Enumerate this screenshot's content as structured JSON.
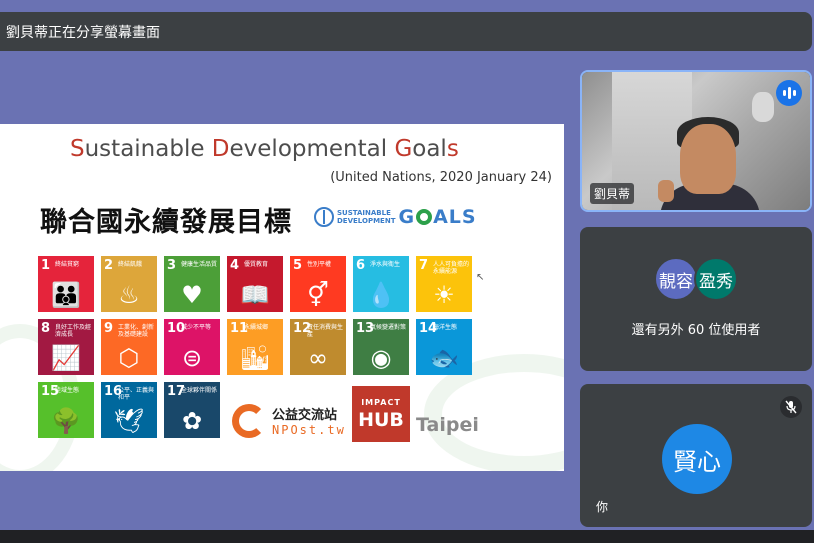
{
  "banner": {
    "text": "劉貝蒂正在分享螢幕畫面"
  },
  "slide": {
    "title_parts": [
      "S",
      "ustainable ",
      "D",
      "evelopmental ",
      "G",
      "oal",
      "s"
    ],
    "date": "(United Nations, 2020 January 24)",
    "cn_title": "聯合國永續發展目標",
    "goals_logo": {
      "small_line1": "SUSTAINABLE",
      "small_line2": "DEVELOPMENT",
      "big_g": "G",
      "big_rest": "ALS"
    },
    "tiles": [
      {
        "num": "1",
        "label": "終結貧窮",
        "icon": "family-icon",
        "glyph": "👪",
        "color": "#e5243b"
      },
      {
        "num": "2",
        "label": "終結飢餓",
        "icon": "bowl-icon",
        "glyph": "♨",
        "color": "#dda63a"
      },
      {
        "num": "3",
        "label": "健康生活品質",
        "icon": "heartbeat-icon",
        "glyph": "♥",
        "color": "#4c9f38"
      },
      {
        "num": "4",
        "label": "優質教育",
        "icon": "book-icon",
        "glyph": "📖",
        "color": "#c5192d"
      },
      {
        "num": "5",
        "label": "性別平權",
        "icon": "gender-icon",
        "glyph": "⚥",
        "color": "#ff3a21"
      },
      {
        "num": "6",
        "label": "淨水與衛生",
        "icon": "water-icon",
        "glyph": "💧",
        "color": "#26bde2"
      },
      {
        "num": "7",
        "label": "人人可負擔的永續能源",
        "icon": "sun-icon",
        "glyph": "☀",
        "color": "#fcc30b"
      },
      {
        "num": "8",
        "label": "良好工作及經濟成長",
        "icon": "growth-icon",
        "glyph": "📈",
        "color": "#a21942"
      },
      {
        "num": "9",
        "label": "工業化、創新及基礎建設",
        "icon": "cubes-icon",
        "glyph": "⬡",
        "color": "#fd6925"
      },
      {
        "num": "10",
        "label": "減少不平等",
        "icon": "equal-icon",
        "glyph": "⊜",
        "color": "#dd1367"
      },
      {
        "num": "11",
        "label": "永續城鄉",
        "icon": "city-icon",
        "glyph": "🏙",
        "color": "#fd9d24"
      },
      {
        "num": "12",
        "label": "責任消費與生產",
        "icon": "infinity-icon",
        "glyph": "∞",
        "color": "#bf8b2e"
      },
      {
        "num": "13",
        "label": "氣候變遷對策",
        "icon": "eye-icon",
        "glyph": "◉",
        "color": "#3f7e44"
      },
      {
        "num": "14",
        "label": "海洋生態",
        "icon": "fish-icon",
        "glyph": "🐟",
        "color": "#0a97d9"
      },
      {
        "num": "15",
        "label": "陸域生態",
        "icon": "tree-icon",
        "glyph": "🌳",
        "color": "#56c02b"
      },
      {
        "num": "16",
        "label": "公平、正義與和平",
        "icon": "dove-icon",
        "glyph": "🕊",
        "color": "#00689d"
      },
      {
        "num": "17",
        "label": "全球夥伴關係",
        "icon": "flower-icon",
        "glyph": "✿",
        "color": "#19486a"
      }
    ],
    "npo": {
      "cn": "公益交流站",
      "en": "NPOst.tw"
    },
    "hub": {
      "top": "IMPACT",
      "bottom": "HUB"
    },
    "taipei": "Taipei"
  },
  "tile1": {
    "name": "劉貝蒂"
  },
  "tile2": {
    "avatar1": "靚容",
    "avatar2": "盈秀",
    "others": "還有另外 60 位使用者"
  },
  "tile3": {
    "avatar": "賢心",
    "name": "你"
  },
  "colors": {
    "accent": "#1a73e8",
    "tile_bg": "#3c4043",
    "page_bg": "#6a72b3"
  }
}
